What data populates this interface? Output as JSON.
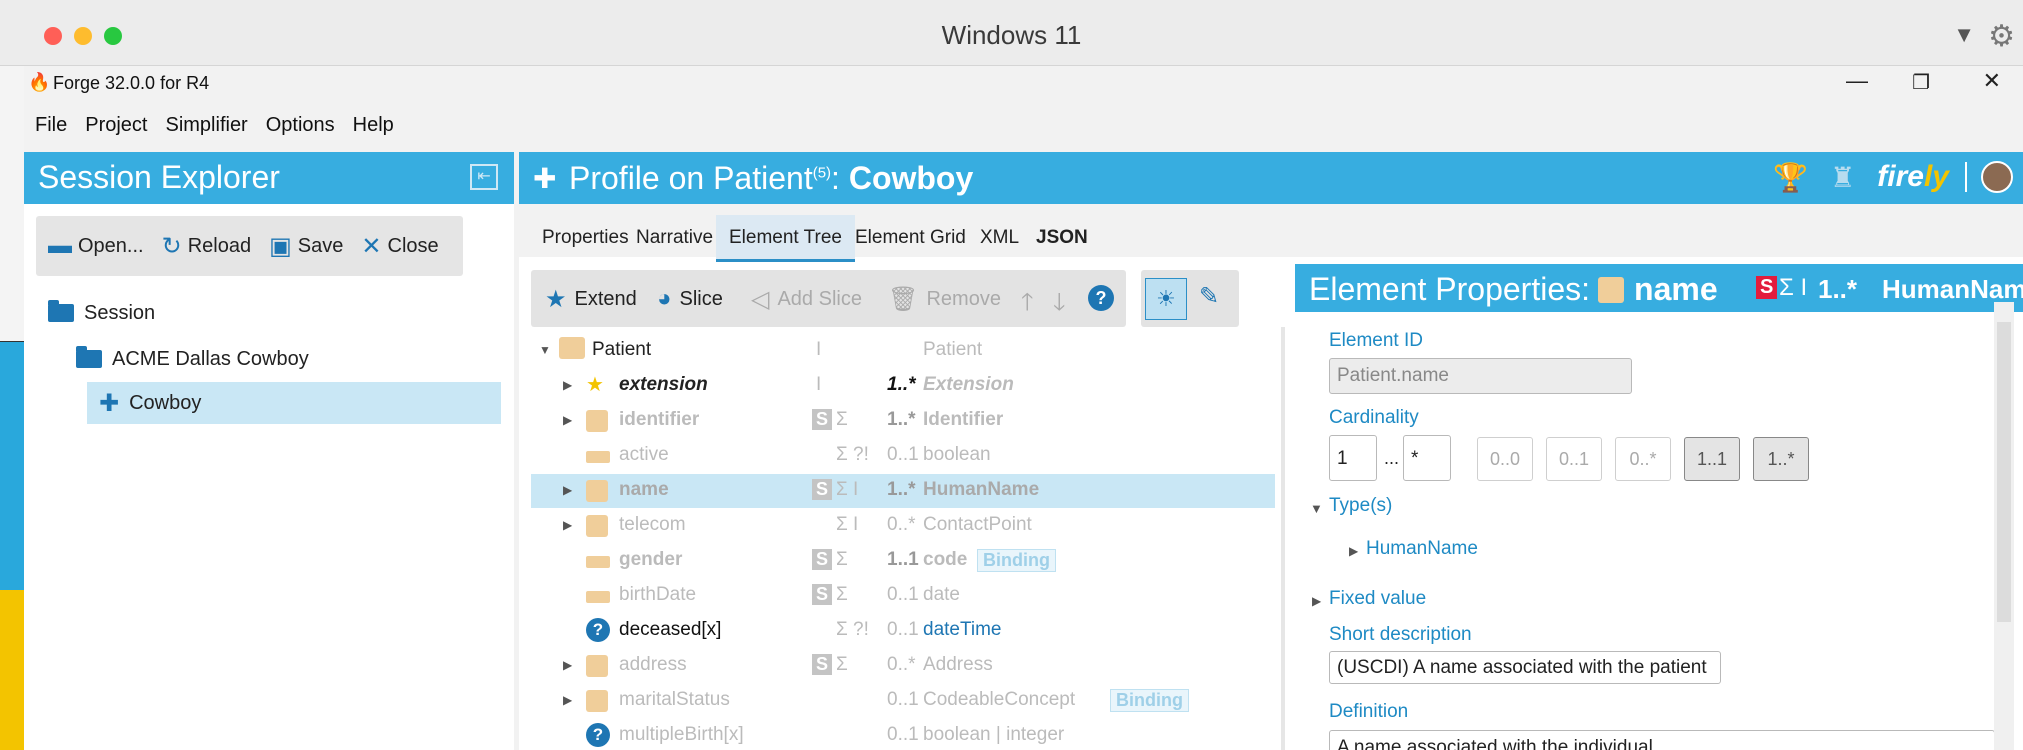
{
  "os": {
    "window_title": "Windows 11"
  },
  "app": {
    "title": "Forge 32.0.0 for R4",
    "menu": [
      "File",
      "Project",
      "Simplifier",
      "Options",
      "Help"
    ]
  },
  "session_explorer": {
    "title": "Session Explorer",
    "toolbar": {
      "open": "Open...",
      "reload": "Reload",
      "save": "Save",
      "close": "Close"
    },
    "tree": {
      "session": "Session",
      "project": "ACME Dallas Cowboy",
      "profile": "Cowboy"
    }
  },
  "profile": {
    "title_prefix": "Profile on Patient",
    "count": "(5)",
    "separator": ":",
    "name": "Cowboy",
    "brand": {
      "fire": "fire",
      "ly": "ly"
    }
  },
  "tabs": [
    "Properties",
    "Narrative",
    "Element Tree",
    "Element Grid",
    "XML",
    "JSON"
  ],
  "element_toolbar": {
    "extend": "Extend",
    "slice": "Slice",
    "add_slice": "Add Slice",
    "remove": "Remove"
  },
  "elements": [
    {
      "name": "Patient",
      "flags": "I",
      "card": "",
      "type": "Patient"
    },
    {
      "name": "extension",
      "flags": "I",
      "card": "1..*",
      "type": "Extension"
    },
    {
      "name": "identifier",
      "s": "S",
      "flags": "Σ",
      "card": "1..*",
      "type": "Identifier"
    },
    {
      "name": "active",
      "flags": "Σ ?!",
      "card": "0..1",
      "type": "boolean"
    },
    {
      "name": "name",
      "s": "S",
      "flags": "Σ I",
      "card": "1..*",
      "type": "HumanName"
    },
    {
      "name": "telecom",
      "flags": "Σ I",
      "card": "0..*",
      "type": "ContactPoint"
    },
    {
      "name": "gender",
      "s": "S",
      "flags": "Σ",
      "card": "1..1",
      "type": "code",
      "binding": "Binding"
    },
    {
      "name": "birthDate",
      "s": "S",
      "flags": "Σ",
      "card": "0..1",
      "type": "date"
    },
    {
      "name": "deceased[x]",
      "flags": "Σ ?!",
      "card": "0..1",
      "type": "dateTime"
    },
    {
      "name": "address",
      "s": "S",
      "flags": "Σ",
      "card": "0..*",
      "type": "Address"
    },
    {
      "name": "maritalStatus",
      "flags": "",
      "card": "0..1",
      "type": "CodeableConcept",
      "binding": "Binding"
    },
    {
      "name": "multipleBirth[x]",
      "flags": "",
      "card": "0..1",
      "type": "boolean | integer"
    }
  ],
  "element_properties": {
    "title": "Element Properties:",
    "name": "name",
    "s_flag": "S",
    "flags": "Σ I",
    "card": "1..*",
    "type": "HumanNam",
    "element_id_label": "Element ID",
    "element_id": "Patient.name",
    "cardinality_label": "Cardinality",
    "min": "1",
    "dots": "...",
    "max": "*",
    "card_buttons": [
      "0..0",
      "0..1",
      "0..*",
      "1..1",
      "1..*"
    ],
    "types_label": "Type(s)",
    "type_item": "HumanName",
    "fixed_value_label": "Fixed value",
    "short_label": "Short description",
    "short_value": "(USCDI) A name associated with the patient",
    "definition_label": "Definition",
    "definition_value": "A name associated with the individual."
  },
  "colors": {
    "accent": "#37ade0",
    "selected": "#c9e7f5",
    "link": "#1e8ac4"
  }
}
